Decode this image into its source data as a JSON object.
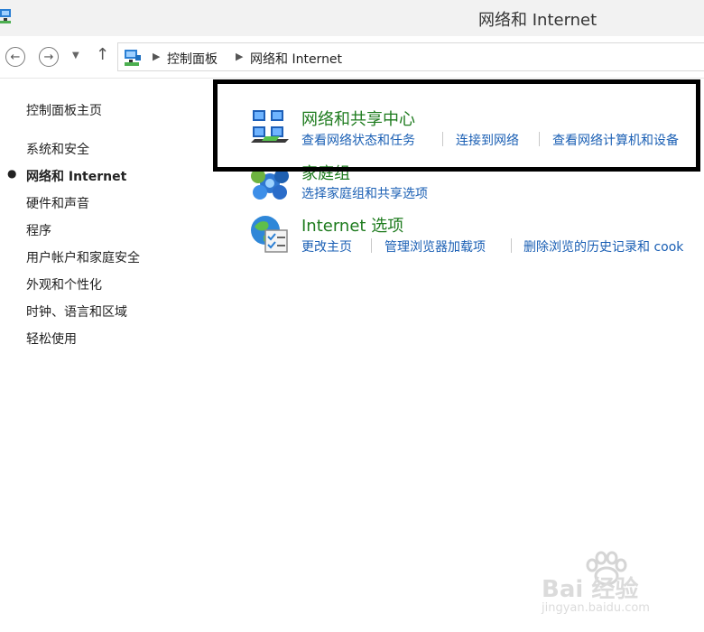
{
  "window": {
    "title": "网络和 Internet"
  },
  "breadcrumb": {
    "items": [
      "控制面板",
      "网络和 Internet"
    ]
  },
  "sidebar": {
    "home": "控制面板主页",
    "items": [
      {
        "label": "系统和安全"
      },
      {
        "label": "网络和 Internet"
      },
      {
        "label": "硬件和声音"
      },
      {
        "label": "程序"
      },
      {
        "label": "用户帐户和家庭安全"
      },
      {
        "label": "外观和个性化"
      },
      {
        "label": "时钟、语言和区域"
      },
      {
        "label": "轻松使用"
      }
    ]
  },
  "categories": [
    {
      "title": "网络和共享中心",
      "icon": "network-sharing-center-icon",
      "links": [
        "查看网络状态和任务",
        "连接到网络",
        "查看网络计算机和设备"
      ]
    },
    {
      "title": "家庭组",
      "icon": "homegroup-icon",
      "links": [
        "选择家庭组和共享选项"
      ]
    },
    {
      "title": "Internet 选项",
      "icon": "internet-options-icon",
      "links": [
        "更改主页",
        "管理浏览器加载项",
        "删除浏览的历史记录和 cook"
      ]
    }
  ],
  "watermark": {
    "logo": "Bai 经验",
    "url": "jingyan.baidu.com"
  },
  "colors": {
    "category_title": "#1e7b1e",
    "link": "#1a5fb4",
    "highlight_box": "#000000"
  }
}
